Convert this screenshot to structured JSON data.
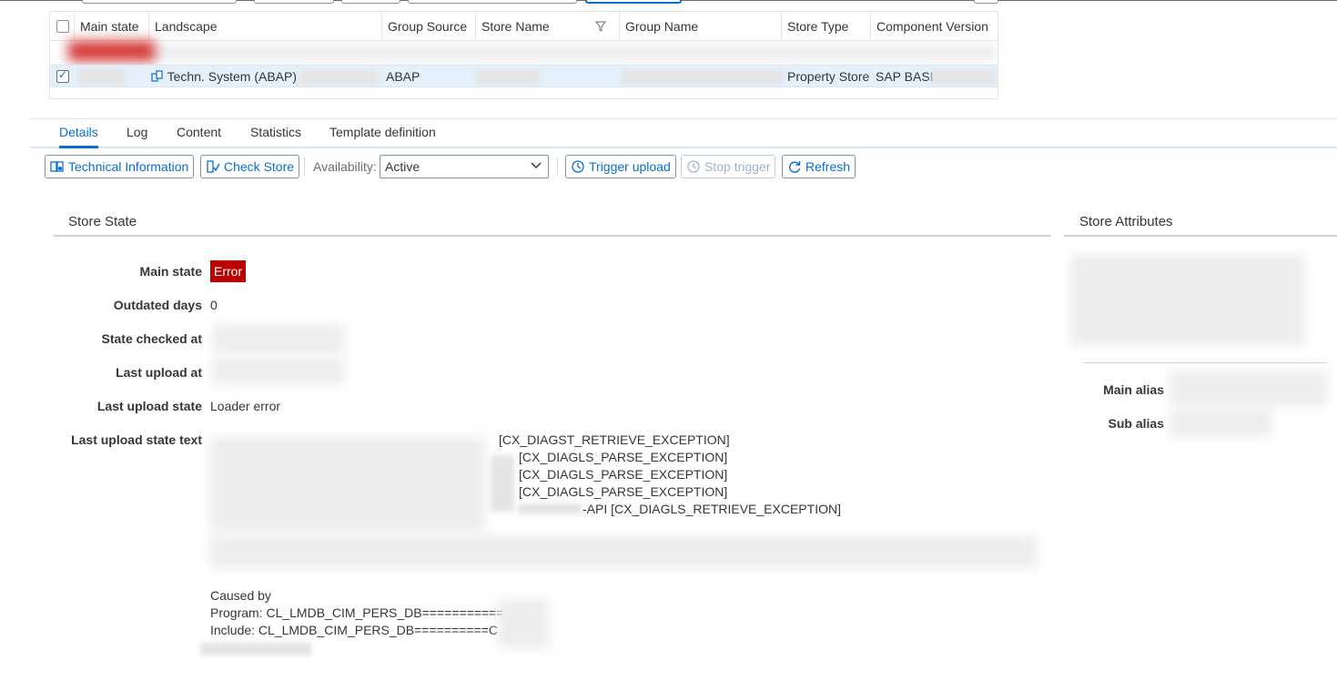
{
  "table": {
    "columns": [
      "Main state",
      "Landscape",
      "Group Source",
      "Store Name",
      "Group Name",
      "Store Type",
      "Component Version"
    ],
    "selected_row": {
      "landscape": "Techn. System (ABAP)",
      "group_source": "ABAP",
      "store_type": "Property Store",
      "component_version": "SAP BASI"
    }
  },
  "tabs": [
    "Details",
    "Log",
    "Content",
    "Statistics",
    "Template definition"
  ],
  "toolbar": {
    "technical_information": "Technical Information",
    "check_store": "Check Store",
    "availability_label": "Availability:",
    "availability_value": "Active",
    "trigger_upload": "Trigger upload",
    "stop_trigger": "Stop trigger",
    "refresh": "Refresh"
  },
  "store_state": {
    "title": "Store State",
    "labels": {
      "main_state": "Main state",
      "outdated_days": "Outdated days",
      "state_checked_at": "State checked at",
      "last_upload_at": "Last upload at",
      "last_upload_state": "Last upload state",
      "last_upload_state_text": "Last upload state text"
    },
    "main_state": "Error",
    "outdated_days": "0",
    "last_upload_state": "Loader error",
    "error_lines": [
      "[CX_DIAGST_RETRIEVE_EXCEPTION]",
      "[CX_DIAGLS_PARSE_EXCEPTION]",
      "[CX_DIAGLS_PARSE_EXCEPTION]",
      "[CX_DIAGLS_PARSE_EXCEPTION]",
      "-API [CX_DIAGLS_RETRIEVE_EXCEPTION]"
    ],
    "caused_by": "Caused by",
    "program": "Program: CL_LMDB_CIM_PERS_DB===========",
    "include": "Include: CL_LMDB_CIM_PERS_DB==========C"
  },
  "store_attributes": {
    "title": "Store Attributes",
    "main_alias": "Main alias",
    "sub_alias": "Sub alias"
  },
  "colors": {
    "accent": "#0a6ed1",
    "error": "#bb0000",
    "selected_row": "#e5f0fa"
  }
}
